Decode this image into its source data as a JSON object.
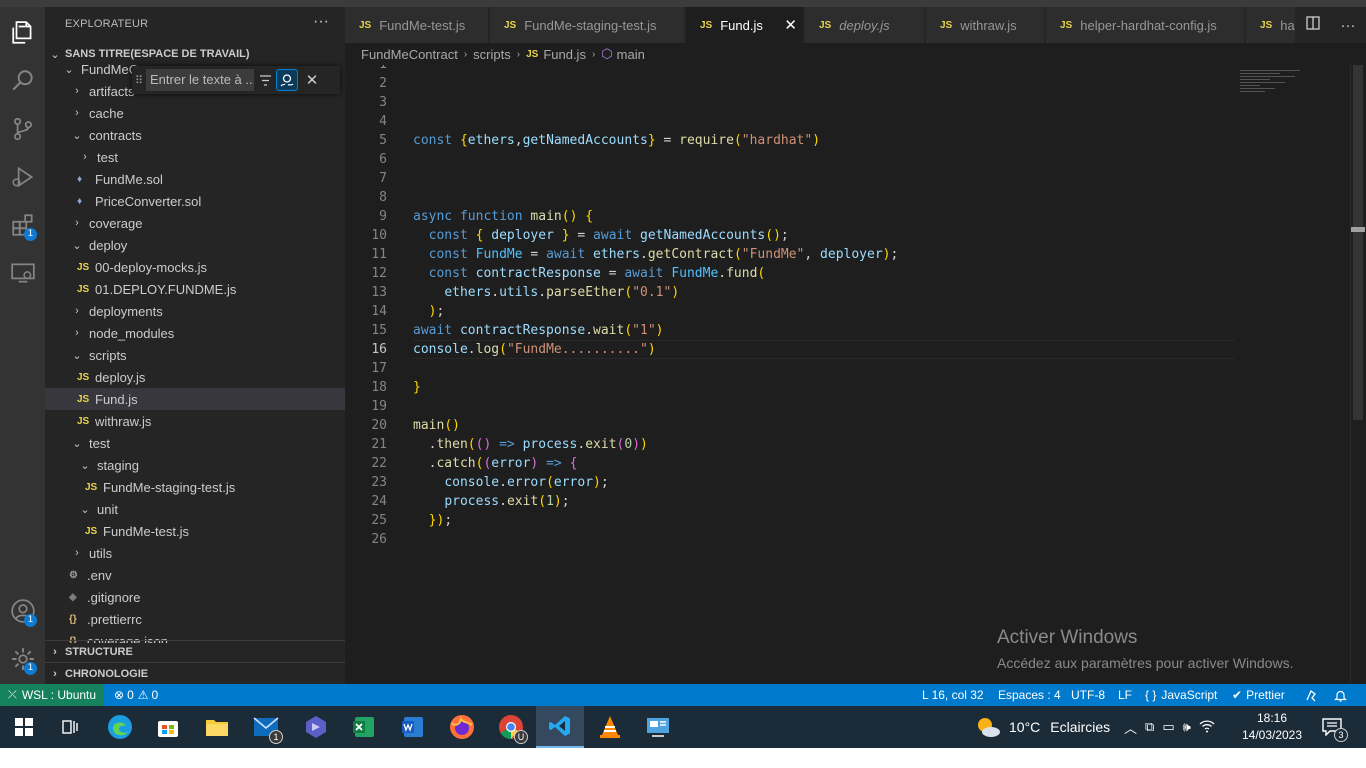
{
  "explorer": {
    "title": "EXPLORATEUR",
    "more": "···",
    "workspace": "SANS TITRE(ESPACE DE TRAVAIL)",
    "structure": "STRUCTURE",
    "timeline": "CHRONOLOGIE",
    "tree": [
      {
        "label": "FundMeC",
        "twisty": "⌄",
        "icon": "",
        "kind": "folder"
      },
      {
        "label": "artifacts",
        "twisty": "›",
        "icon": "",
        "kind": "folder"
      },
      {
        "label": "cache",
        "twisty": "›",
        "icon": "",
        "kind": "folder"
      },
      {
        "label": "contracts",
        "twisty": "⌄",
        "icon": "",
        "kind": "folder"
      },
      {
        "label": "test",
        "twisty": "›",
        "icon": "",
        "kind": "folder"
      },
      {
        "label": "FundMe.sol",
        "twisty": "",
        "icon": "♦",
        "kind": "sol"
      },
      {
        "label": "PriceConverter.sol",
        "twisty": "",
        "icon": "♦",
        "kind": "sol"
      },
      {
        "label": "coverage",
        "twisty": "›",
        "icon": "",
        "kind": "folder"
      },
      {
        "label": "deploy",
        "twisty": "⌄",
        "icon": "",
        "kind": "folder"
      },
      {
        "label": "00-deploy-mocks.js",
        "twisty": "",
        "icon": "JS",
        "kind": "js"
      },
      {
        "label": "01.DEPLOY.FUNDME.js",
        "twisty": "",
        "icon": "JS",
        "kind": "js"
      },
      {
        "label": "deployments",
        "twisty": "›",
        "icon": "",
        "kind": "folder"
      },
      {
        "label": "node_modules",
        "twisty": "›",
        "icon": "",
        "kind": "folder"
      },
      {
        "label": "scripts",
        "twisty": "⌄",
        "icon": "",
        "kind": "folder"
      },
      {
        "label": "deploy.js",
        "twisty": "",
        "icon": "JS",
        "kind": "js"
      },
      {
        "label": "Fund.js",
        "twisty": "",
        "icon": "JS",
        "kind": "js"
      },
      {
        "label": "withraw.js",
        "twisty": "",
        "icon": "JS",
        "kind": "js"
      },
      {
        "label": "test",
        "twisty": "⌄",
        "icon": "",
        "kind": "folder"
      },
      {
        "label": "staging",
        "twisty": "⌄",
        "icon": "",
        "kind": "folder"
      },
      {
        "label": "FundMe-staging-test.js",
        "twisty": "",
        "icon": "JS",
        "kind": "js"
      },
      {
        "label": "unit",
        "twisty": "⌄",
        "icon": "",
        "kind": "folder"
      },
      {
        "label": "FundMe-test.js",
        "twisty": "",
        "icon": "JS",
        "kind": "js"
      },
      {
        "label": "utils",
        "twisty": "›",
        "icon": "",
        "kind": "folder"
      },
      {
        "label": ".env",
        "twisty": "",
        "icon": "⚙",
        "kind": "gear"
      },
      {
        "label": ".gitignore",
        "twisty": "",
        "icon": "◆",
        "kind": "git"
      },
      {
        "label": ".prettierrc",
        "twisty": "",
        "icon": "{}",
        "kind": "json"
      },
      {
        "label": "coverage.json",
        "twisty": "",
        "icon": "{}",
        "kind": "json"
      }
    ],
    "selected_index": 15
  },
  "find_widget": {
    "placeholder": "Entrer le texte à ..."
  },
  "activity_bar": {
    "extensions_badge": "1",
    "accounts_badge": "1",
    "manage_badge": "1"
  },
  "tabs": [
    {
      "icon": "JS",
      "label": "FundMe-test.js",
      "active": false,
      "italic": false
    },
    {
      "icon": "JS",
      "label": "FundMe-staging-test.js",
      "active": false,
      "italic": false
    },
    {
      "icon": "JS",
      "label": "Fund.js",
      "active": true,
      "italic": false
    },
    {
      "icon": "JS",
      "label": "deploy.js",
      "active": false,
      "italic": true
    },
    {
      "icon": "JS",
      "label": "withraw.js",
      "active": false,
      "italic": false
    },
    {
      "icon": "JS",
      "label": "helper-hardhat-config.js",
      "active": false,
      "italic": false
    },
    {
      "icon": "JS",
      "label": "harc",
      "active": false,
      "italic": false
    }
  ],
  "breadcrumb": {
    "project": "FundMeContract",
    "folder": "scripts",
    "file": "Fund.js",
    "symbol": "main"
  },
  "code": {
    "current_line": 16,
    "lines": [
      "",
      "",
      "",
      "",
      "const {ethers,getNamedAccounts} = require(\"hardhat\")",
      "",
      "",
      "",
      "async function main() {",
      "  const { deployer } = await getNamedAccounts();",
      "  const FundMe = await ethers.getContract(\"FundMe\", deployer);",
      "  const contractResponse = await FundMe.fund(",
      "    ethers.utils.parseEther(\"0.1\")",
      "  );",
      "await contractResponse.wait(\"1\")",
      "console.log(\"FundMe..........\")",
      "",
      "}",
      "",
      "main()",
      "  .then(() => process.exit(0))",
      "  .catch((error) => {",
      "    console.error(error);",
      "    process.exit(1);",
      "  });",
      ""
    ]
  },
  "watermark": {
    "title": "Activer Windows",
    "subtitle": "Accédez aux paramètres pour activer Windows."
  },
  "statusbar": {
    "remote": "WSL : Ubuntu",
    "errors": "0",
    "warnings": "0",
    "position": "L 16, col 32",
    "spaces": "Espaces : 4",
    "encoding": "UTF-8",
    "eol": "LF",
    "language": "JavaScript",
    "formatter": "Prettier"
  },
  "taskbar": {
    "mail_badge": "1",
    "chrome_badge": "U",
    "weather_temp": "10°C",
    "weather_text": "Eclaircies",
    "time": "18:16",
    "date": "14/03/2023",
    "notifications": "3"
  },
  "colors": {
    "accent": "#007acc",
    "remote": "#16825d",
    "editor_bg": "#1e1e1e",
    "sidebar_bg": "#252526"
  }
}
